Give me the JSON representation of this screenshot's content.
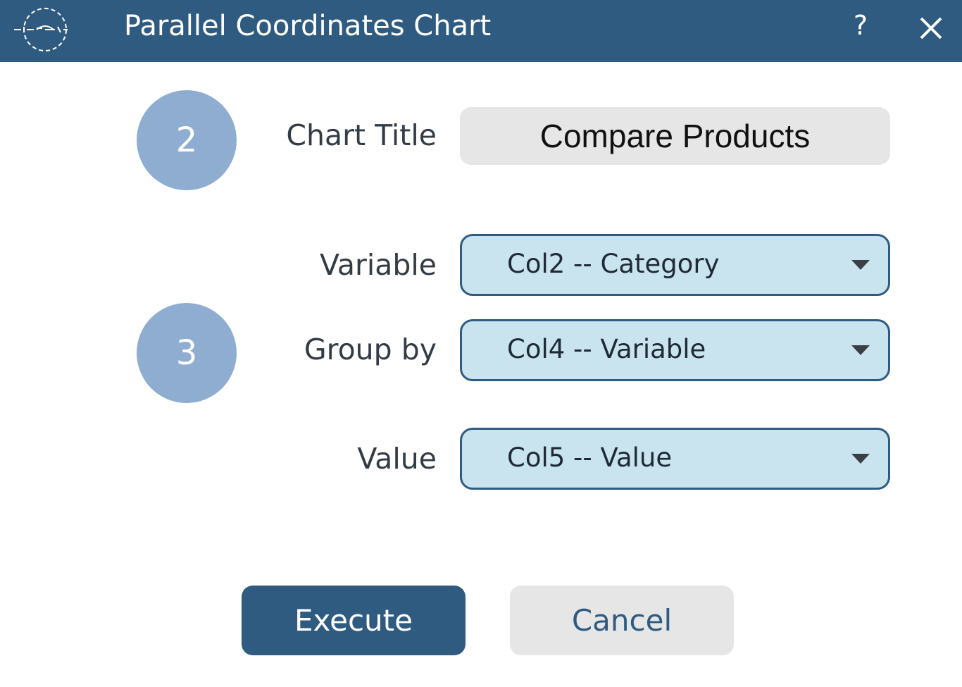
{
  "window": {
    "title": "Parallel Coordinates Chart",
    "help_label": "?",
    "icons": {
      "logo": "circular-logo-icon",
      "close": "close-icon",
      "dropdown": "triangle-down-icon"
    }
  },
  "steps": {
    "step2": "2",
    "step3": "3"
  },
  "form": {
    "chart_title": {
      "label": "Chart Title",
      "value": "Compare Products"
    },
    "variable": {
      "label": "Variable",
      "selected": "Col2 -- Category"
    },
    "group_by": {
      "label": "Group by",
      "selected": "Col4 -- Variable"
    },
    "value": {
      "label": "Value",
      "selected": "Col5 -- Value"
    }
  },
  "buttons": {
    "execute": "Execute",
    "cancel": "Cancel"
  },
  "colors": {
    "titlebar": "#305b80",
    "badge": "#8eadd1",
    "dropdown_bg": "#c9e4ee",
    "input_bg": "#e6e6e6",
    "primary_button": "#305b80"
  }
}
